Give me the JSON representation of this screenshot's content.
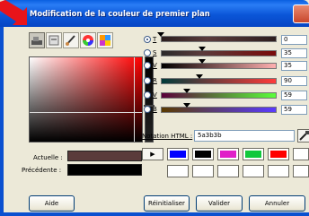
{
  "window": {
    "title": "Modification de la couleur de premier plan"
  },
  "toolbar": {
    "icons": [
      "color-picker-tool-icon",
      "scale-tool-icon",
      "brush-tool-icon",
      "color-wheel-icon",
      "palette-icon"
    ],
    "active": 0
  },
  "colors": {
    "current_hex": "#5a3b3b",
    "previous_hex": "#000000",
    "titlebar": "#0a5fe0"
  },
  "labels": {
    "current": "Actuelle :",
    "previous": "Précédente :"
  },
  "channels": [
    {
      "label": "T",
      "value": "0",
      "selected": true
    },
    {
      "label": "S",
      "value": "35",
      "selected": false
    },
    {
      "label": "V",
      "value": "35",
      "selected": false
    },
    {
      "label": "R",
      "value": "90",
      "selected": false
    },
    {
      "label": "V",
      "value": "59",
      "selected": false
    },
    {
      "label": "B",
      "value": "59",
      "selected": false
    }
  ],
  "html": {
    "label": "Notation HTML :",
    "value": "5a3b3b"
  },
  "history": {
    "arrow": "▶",
    "row1": [
      "#0000ff",
      "#000000",
      "#e020c8",
      "#10c83c",
      "#ff0000",
      "#ffffff"
    ],
    "row2": [
      "#ffffff",
      "#ffffff",
      "#ffffff",
      "#ffffff",
      "#ffffff",
      "#ffffff"
    ]
  },
  "buttons": {
    "help": "Aide",
    "reset": "Réinitialiser",
    "ok": "Valider",
    "cancel": "Annuler"
  }
}
